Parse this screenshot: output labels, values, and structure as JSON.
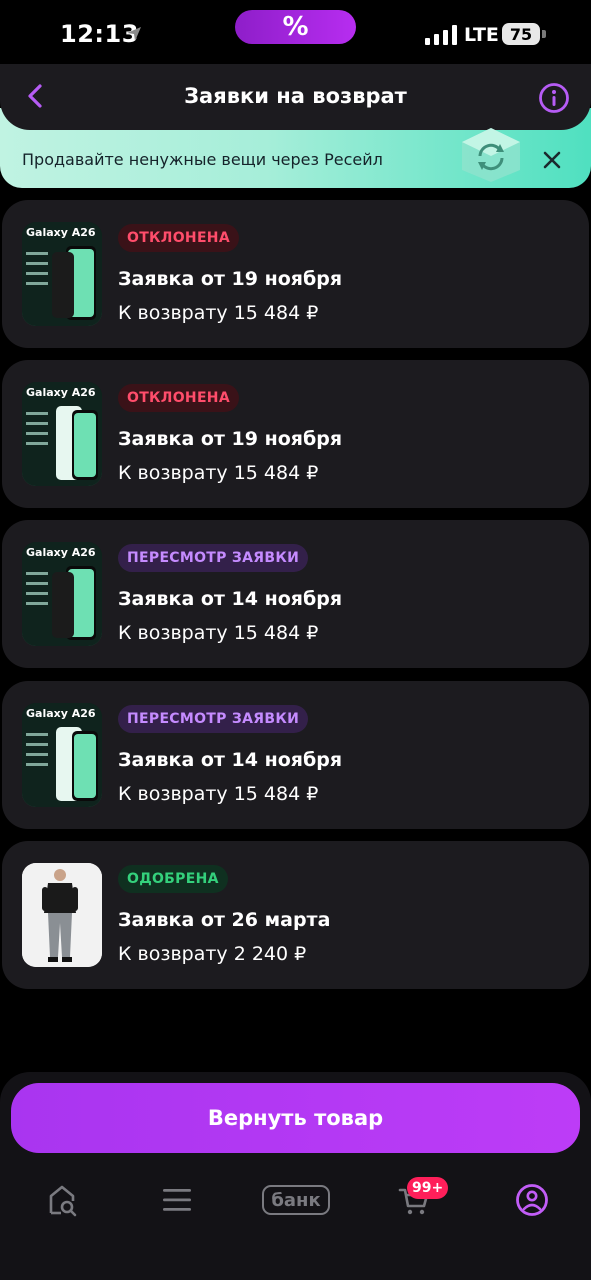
{
  "status_bar": {
    "time": "12:13",
    "island_label": "%",
    "network": "LTE",
    "battery": "75"
  },
  "header": {
    "title": "Заявки на возврат"
  },
  "banner": {
    "text": "Продавайте ненужные вещи через Ресейл"
  },
  "returns": [
    {
      "product_label": "Galaxy A26",
      "status": "ОТКЛОНЕНА",
      "status_type": "declined",
      "title": "Заявка от 19 ноября",
      "refund": "К возврату 15 484 ₽"
    },
    {
      "product_label": "Galaxy A26",
      "status": "ОТКЛОНЕНА",
      "status_type": "declined",
      "title": "Заявка от 19 ноября",
      "refund": "К возврату 15 484 ₽"
    },
    {
      "product_label": "Galaxy A26",
      "status": "ПЕРЕСМОТР ЗАЯВКИ",
      "status_type": "review",
      "title": "Заявка от 14 ноября",
      "refund": "К возврату 15 484 ₽"
    },
    {
      "product_label": "Galaxy A26",
      "status": "ПЕРЕСМОТР ЗАЯВКИ",
      "status_type": "review",
      "title": "Заявка от 14 ноября",
      "refund": "К возврату 15 484 ₽"
    },
    {
      "product_label": "",
      "status": "ОДОБРЕНА",
      "status_type": "approved",
      "title": "Заявка от 26 марта",
      "refund": "К возврату 2 240 ₽"
    }
  ],
  "cta": {
    "label": "Вернуть товар"
  },
  "tab_bar": {
    "bank_label": "банк",
    "cart_badge": "99+"
  },
  "colors": {
    "accent": "#b136f3",
    "declined": "#ff4d6b",
    "review": "#c58bff",
    "approved": "#34d17c",
    "banner_start": "#c0f3e2",
    "banner_end": "#4fe0c0"
  },
  "icons": {
    "back": "chevron-left-icon",
    "info": "info-circle-icon",
    "close": "close-icon",
    "home": "home-search-icon",
    "catalog": "menu-icon",
    "cart": "cart-icon",
    "profile": "profile-icon"
  }
}
